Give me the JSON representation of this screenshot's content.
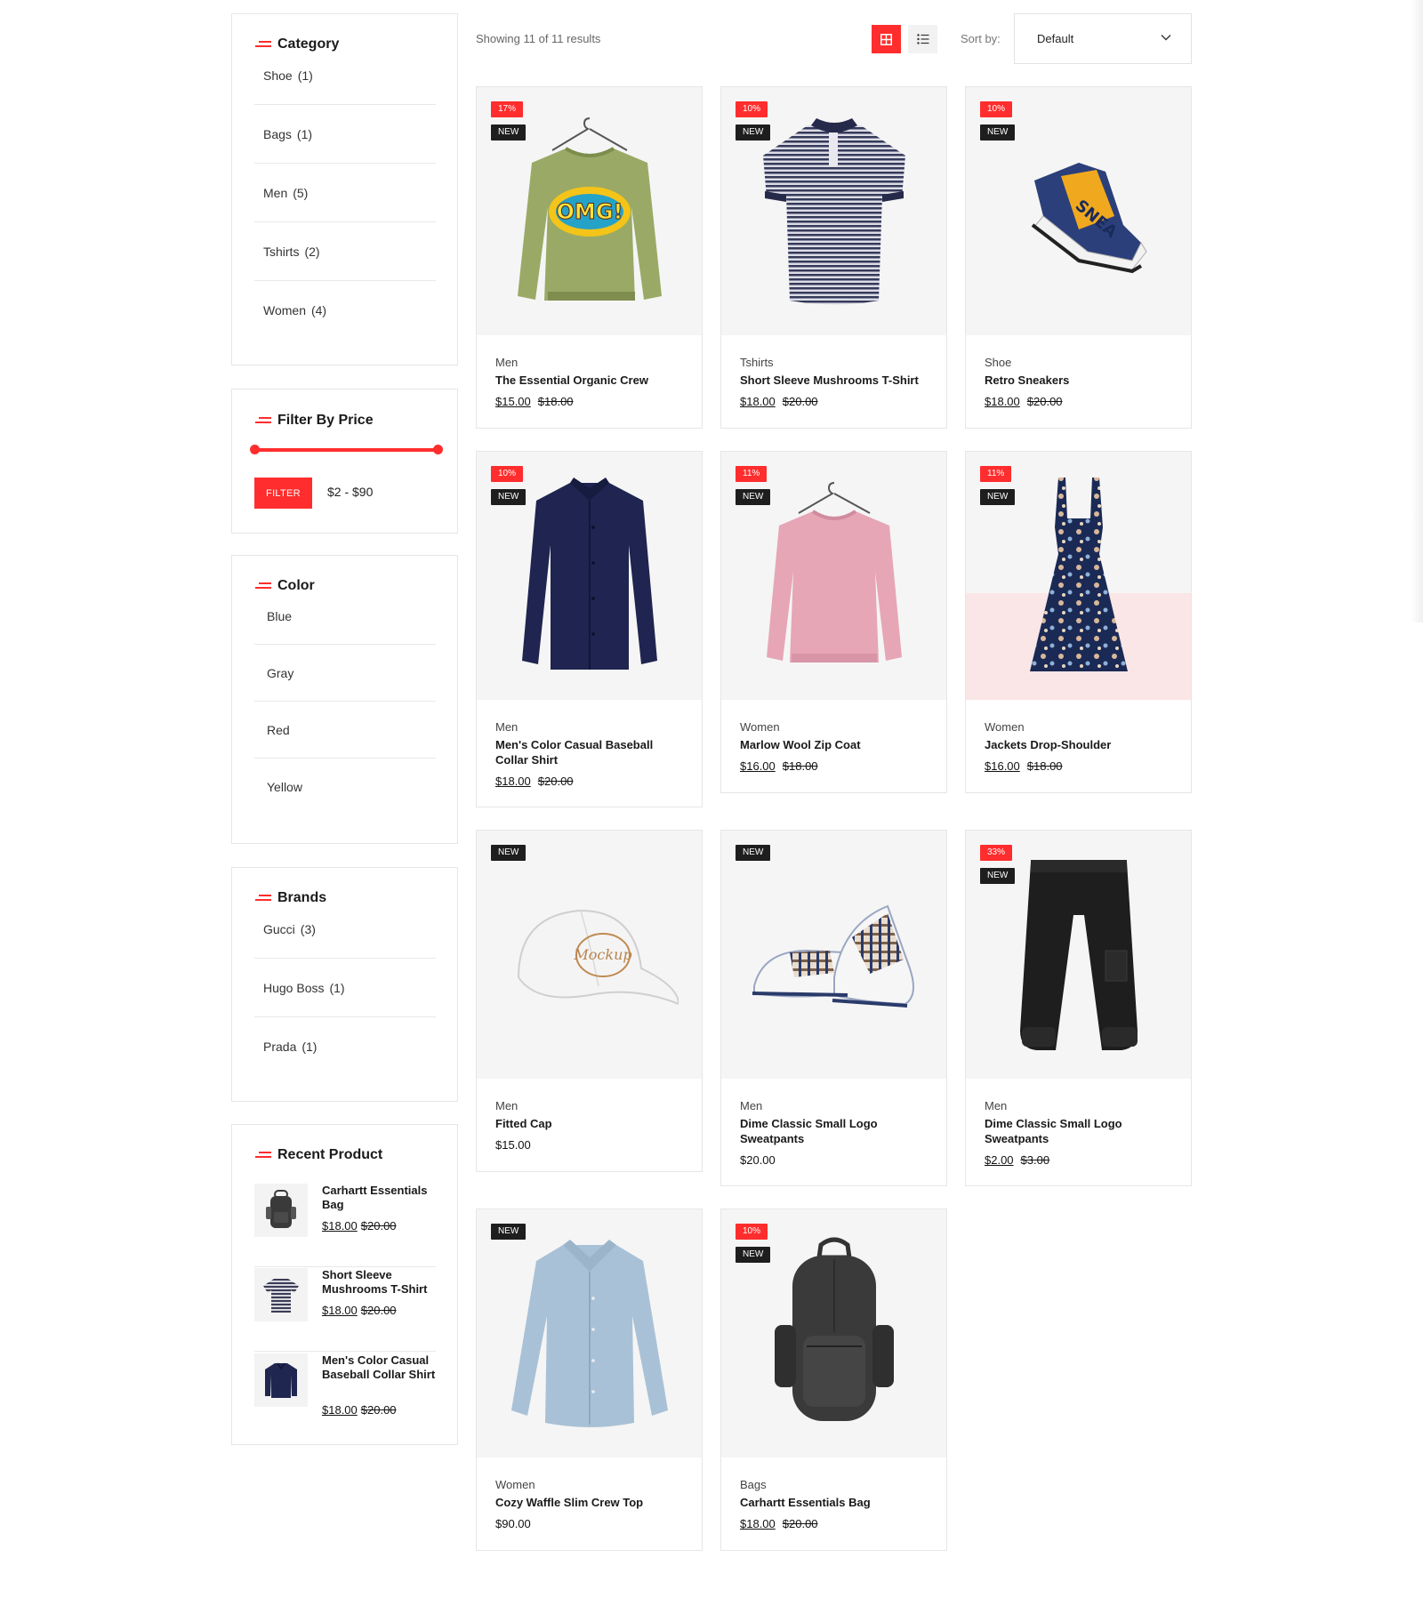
{
  "sidebar": {
    "category": {
      "title": "Category",
      "items": [
        {
          "label": "Shoe",
          "count": "(1)"
        },
        {
          "label": "Bags",
          "count": "(1)"
        },
        {
          "label": "Men",
          "count": "(5)"
        },
        {
          "label": "Tshirts",
          "count": "(2)"
        },
        {
          "label": "Women",
          "count": "(4)"
        }
      ]
    },
    "price_filter": {
      "title": "Filter By Price",
      "button_label": "FILTER",
      "range_text": "$2 - $90",
      "min_fraction": 0.0,
      "max_fraction": 1.0
    },
    "color": {
      "title": "Color",
      "items": [
        "Blue",
        "Gray",
        "Red",
        "Yellow"
      ]
    },
    "brands": {
      "title": "Brands",
      "items": [
        {
          "label": "Gucci",
          "count": "(3)"
        },
        {
          "label": "Hugo Boss",
          "count": "(1)"
        },
        {
          "label": "Prada",
          "count": "(1)"
        }
      ]
    },
    "recent": {
      "title": "Recent Product",
      "items": [
        {
          "name": "Carhartt Essentials Bag",
          "price": "$18.00",
          "old_price": "$20.00",
          "icon": "backpack-icon"
        },
        {
          "name": "Short Sleeve Mushrooms T-Shirt",
          "price": "$18.00",
          "old_price": "$20.00",
          "icon": "striped-tshirt-icon"
        },
        {
          "name": "Men's Color Casual Baseball Collar Shirt",
          "price": "$18.00",
          "old_price": "$20.00",
          "icon": "shirt-icon"
        }
      ]
    }
  },
  "toolbar": {
    "results_text": "Showing 11 of 11 results",
    "sort_label": "Sort by:",
    "sort_value": "Default",
    "active_view": "grid"
  },
  "products": [
    {
      "sale": "17%",
      "new": "NEW",
      "category": "Men",
      "name": "The Essential Organic Crew",
      "price": "$15.00",
      "old_price": "$18.00",
      "icon": "sweatshirt-icon"
    },
    {
      "sale": "10%",
      "new": "NEW",
      "category": "Tshirts",
      "name": "Short Sleeve Mushrooms T-Shirt",
      "price": "$18.00",
      "old_price": "$20.00",
      "icon": "polo-shirt-icon"
    },
    {
      "sale": "10%",
      "new": "NEW",
      "category": "Shoe",
      "name": "Retro Sneakers",
      "price": "$18.00",
      "old_price": "$20.00",
      "icon": "sneaker-icon"
    },
    {
      "sale": "10%",
      "new": "NEW",
      "category": "Men",
      "name": "Men's Color Casual Baseball Collar Shirt",
      "price": "$18.00",
      "old_price": "$20.00",
      "icon": "shirt-icon"
    },
    {
      "sale": "11%",
      "new": "NEW",
      "category": "Women",
      "name": "Marlow Wool Zip Coat",
      "price": "$16.00",
      "old_price": "$18.00",
      "icon": "sweater-icon"
    },
    {
      "sale": "11%",
      "new": "NEW",
      "category": "Women",
      "name": "Jackets Drop-Shoulder",
      "price": "$16.00",
      "old_price": "$18.00",
      "icon": "dress-icon"
    },
    {
      "sale": "",
      "new": "NEW",
      "category": "Men",
      "name": "Fitted Cap",
      "price": "$15.00",
      "old_price": "",
      "icon": "cap-icon"
    },
    {
      "sale": "",
      "new": "NEW",
      "category": "Men",
      "name": "Dime Classic Small Logo Sweatpants",
      "price": "$20.00",
      "old_price": "",
      "icon": "baby-shoes-icon"
    },
    {
      "sale": "33%",
      "new": "NEW",
      "category": "Men",
      "name": "Dime Classic Small Logo Sweatpants",
      "price": "$2.00",
      "old_price": "$3.00",
      "icon": "pants-icon"
    },
    {
      "sale": "",
      "new": "NEW",
      "category": "Women",
      "name": "Cozy Waffle Slim Crew Top",
      "price": "$90.00",
      "old_price": "",
      "icon": "blouse-icon"
    },
    {
      "sale": "10%",
      "new": "NEW",
      "category": "Bags",
      "name": "Carhartt Essentials Bag",
      "price": "$18.00",
      "old_price": "$20.00",
      "icon": "backpack-icon"
    }
  ],
  "colors": {
    "accent": "#ff2d2d",
    "new_badge": "#1e1e1e",
    "card_image_bg": "#f5f5f5"
  }
}
